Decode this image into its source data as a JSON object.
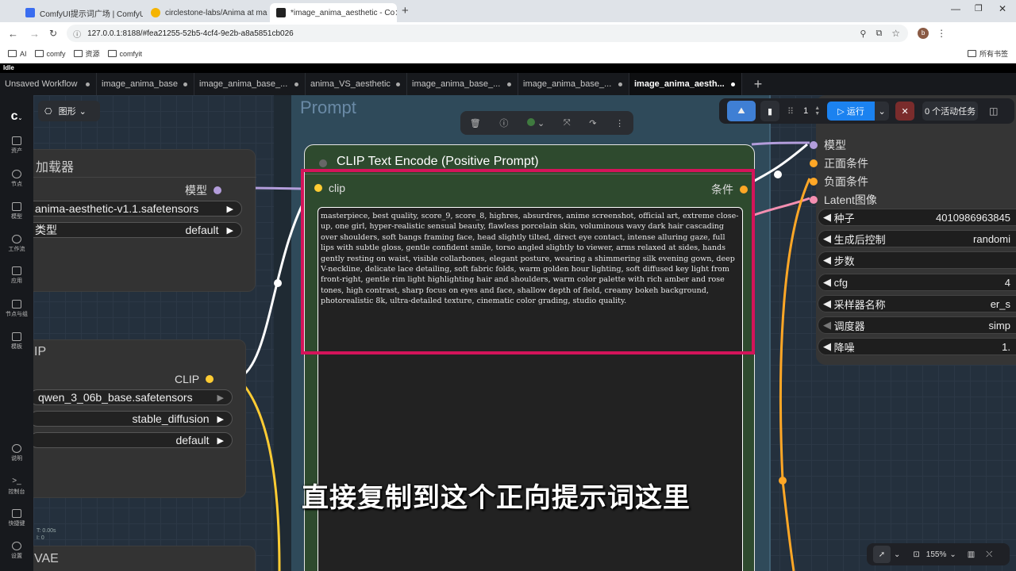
{
  "browser": {
    "tabs": [
      {
        "title": "ComfyUI提示词广场 | ComfyUI",
        "color": "#3a6df0"
      },
      {
        "title": "circlestone-labs/Anima at ma",
        "color": "#f5b400"
      },
      {
        "title": "*image_anima_aesthetic - Co",
        "color": "#222222"
      }
    ],
    "url": "127.0.0.1:8188/#fea21255-52b5-4cf4-9e2b-a8a5851cb026",
    "avatar": "b",
    "bookmarks": [
      "AI",
      "comfy",
      "资源",
      "comfyit"
    ],
    "bookmarks_right": "所有书签"
  },
  "app": {
    "status": "Idle",
    "workflow_tabs": [
      "Unsaved Workflow",
      "image_anima_base",
      "image_anima_base_...",
      "anima_VS_aesthetic",
      "image_anima_base_...",
      "image_anima_base_...",
      "image_anima_aesth..."
    ],
    "mode_label": "图形",
    "sidebar": [
      {
        "label": "资产",
        "icon": "image-icon"
      },
      {
        "label": "节点",
        "icon": "node-icon"
      },
      {
        "label": "模型",
        "icon": "model-icon"
      },
      {
        "label": "工作流",
        "icon": "workflow-icon"
      },
      {
        "label": "应用",
        "icon": "app-icon"
      },
      {
        "label": "节点与组",
        "icon": "tree-icon"
      },
      {
        "label": "模板",
        "icon": "template-icon"
      },
      {
        "label": "说明",
        "icon": "help-icon"
      },
      {
        "label": "控制台",
        "icon": "terminal-icon"
      },
      {
        "label": "快捷键",
        "icon": "keyboard-icon"
      },
      {
        "label": "设置",
        "icon": "gear-icon"
      }
    ],
    "toolbar": {
      "queue_count": "1",
      "run_label": "运行",
      "active_tasks": "0 个活动任务"
    },
    "zoom": "155%"
  },
  "canvas": {
    "group_title": "Prompt",
    "loader": {
      "title": "加载器",
      "output": "模型",
      "model": "anima-aesthetic-v1.1.safetensors",
      "type_label": "类型",
      "type_value": "default"
    },
    "clip_loader": {
      "title": "IP",
      "output": "CLIP",
      "model": "qwen_3_06b_base.safetensors",
      "type": "stable_diffusion",
      "device": "default"
    },
    "vae": {
      "title": "VAE"
    },
    "stats": [
      "T: 0.00s",
      "I: 0"
    ],
    "clip_encode": {
      "title": "CLIP Text Encode (Positive Prompt)",
      "input": "clip",
      "output": "条件",
      "text": "masterpiece, best quality, score_9, score_8, highres, absurdres, anime screenshot, official art, extreme close-up, one girl, hyper-realistic sensual beauty, flawless porcelain skin, voluminous wavy dark hair cascading over shoulders, soft bangs framing face, head slightly tilted, direct eye contact, intense alluring gaze, full lips with subtle gloss, gentle confident smile, torso angled slightly to viewer, arms relaxed at sides, hands gently resting on waist, visible collarbones, elegant posture, wearing a shimmering silk evening gown, deep V-neckline, delicate lace detailing, soft fabric folds, warm golden hour lighting, soft diffused key light from front-right, gentle rim light highlighting hair and shoulders, warm color palette with rich amber and rose tones, high contrast, sharp focus on eyes and face, shallow depth of field, creamy bokeh background, photorealistic 8k, ultra-detailed texture, cinematic color grading, studio quality."
    },
    "sampler": {
      "inputs": [
        {
          "label": "模型",
          "color": "#b39ddb"
        },
        {
          "label": "正面条件",
          "color": "#ffa726"
        },
        {
          "label": "负面条件",
          "color": "#ffa726"
        },
        {
          "label": "Latent图像",
          "color": "#f48fb1"
        }
      ],
      "widgets": [
        {
          "label": "种子",
          "value": "4010986963845"
        },
        {
          "label": "生成后控制",
          "value": "randomi"
        },
        {
          "label": "步数",
          "value": ""
        },
        {
          "label": "cfg",
          "value": "4"
        },
        {
          "label": "采样器名称",
          "value": "er_s"
        },
        {
          "label": "调度器",
          "value": "simp"
        },
        {
          "label": "降噪",
          "value": "1."
        }
      ]
    },
    "subtitle": "直接复制到这个正向提示词这里"
  }
}
